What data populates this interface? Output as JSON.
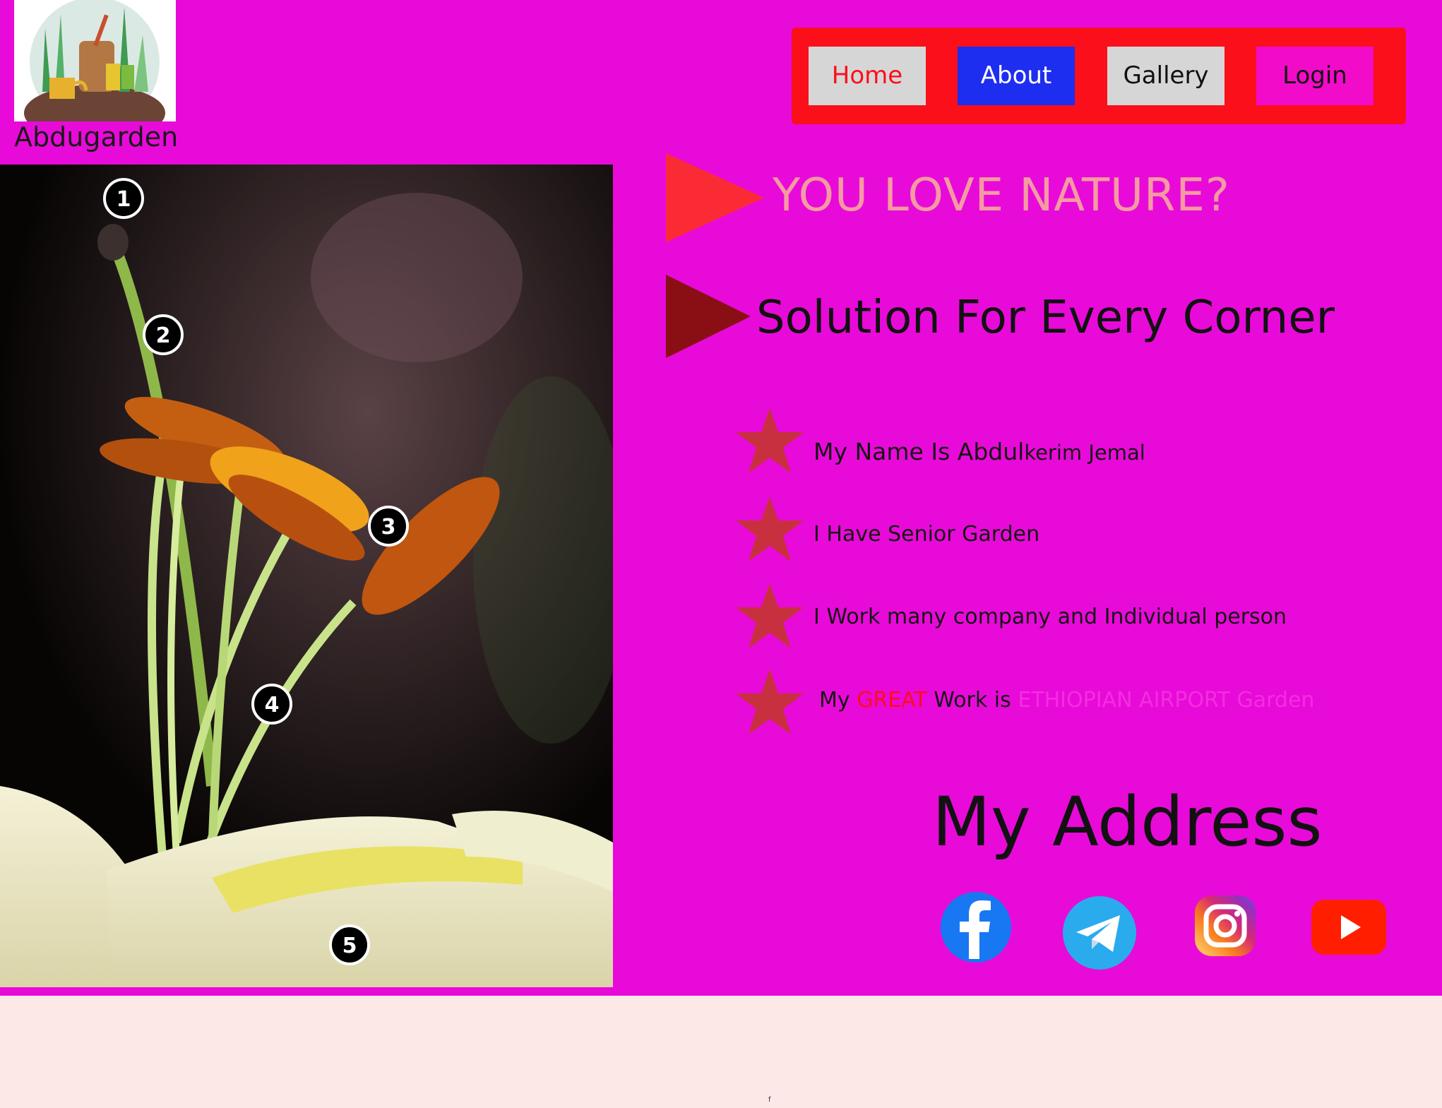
{
  "brand": {
    "name": "Abdugarden",
    "logo_icon": "garden-logo-icon"
  },
  "nav": {
    "items": [
      {
        "label": "Home",
        "color": "#fb0f1a",
        "bg": "#d6d6d6"
      },
      {
        "label": "About",
        "color": "#ffffff",
        "bg": "#1e2ef0"
      },
      {
        "label": "Gallery",
        "color": "#111111",
        "bg": "#d6d6d6"
      },
      {
        "label": "Login",
        "color": "#111111",
        "bg": "#f20bc8"
      }
    ],
    "bar_color": "#fb0f1a"
  },
  "photo": {
    "markers": [
      "1",
      "2",
      "3",
      "4",
      "5"
    ]
  },
  "headings": {
    "tagline": "YOU LOVE NATURE?",
    "subtitle": "Solution For Every Corner"
  },
  "list": {
    "item1_prefix": "My Name Is  Abdul",
    "item1_suffix": "kerim Jemal",
    "item2": "I Have Senior Garden",
    "item3": "I Work  many company and  Individual person",
    "item4_a": "My ",
    "item4_b": "GREAT",
    "item4_c": " Work is ",
    "item4_d": "ETHIOPIAN AIRPORT Garden"
  },
  "address": {
    "title": "My Address",
    "socials": [
      "facebook-icon",
      "telegram-icon",
      "instagram-icon",
      "youtube-icon"
    ]
  },
  "footer": {
    "mark": "f"
  },
  "colors": {
    "background": "#e80ad8",
    "footer": "#fde8e8",
    "star": "#c8303f"
  }
}
